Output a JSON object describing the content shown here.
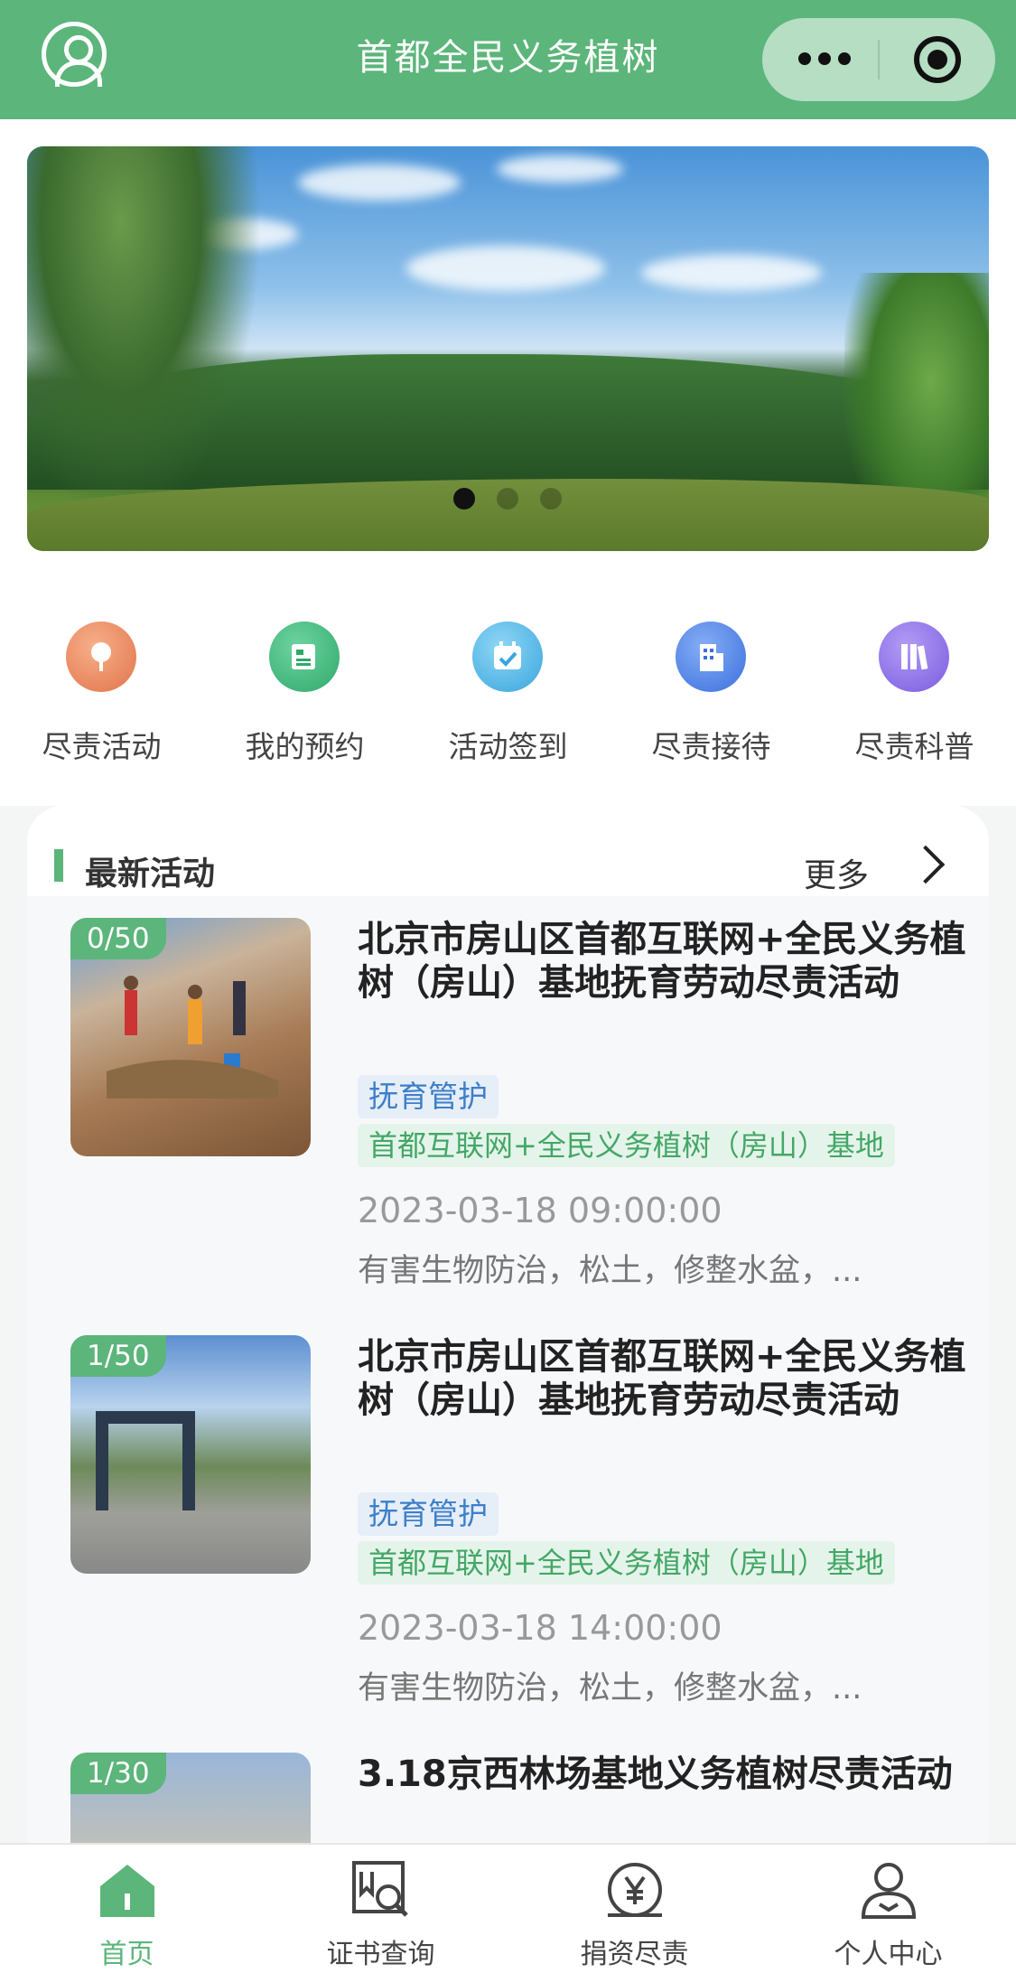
{
  "header": {
    "title": "首都全民义务植树"
  },
  "banner": {
    "slide_count": 3,
    "active_index": 0
  },
  "menu": [
    {
      "label": "尽责活动",
      "icon": "tree-icon",
      "color": "#ef8d5a"
    },
    {
      "label": "我的预约",
      "icon": "news-icon",
      "color": "#3fb87d"
    },
    {
      "label": "活动签到",
      "icon": "calendar-check-icon",
      "color": "#4fb6e8"
    },
    {
      "label": "尽责接待",
      "icon": "building-icon",
      "color": "#4a82e6"
    },
    {
      "label": "尽责科普",
      "icon": "books-icon",
      "color": "#8a6ee6"
    }
  ],
  "section": {
    "title": "最新活动",
    "more": "更多"
  },
  "activities": [
    {
      "count": "0/50",
      "title": "北京市房山区首都互联网+全民义务植树（房山）基地抚育劳动尽责活动",
      "category": "抚育管护",
      "base": "首都互联网+全民义务植树（房山）基地",
      "time": "2023-03-18 09:00:00",
      "desc": "有害生物防治，松土，修整水盆，..."
    },
    {
      "count": "1/50",
      "title": "北京市房山区首都互联网+全民义务植树（房山）基地抚育劳动尽责活动",
      "category": "抚育管护",
      "base": "首都互联网+全民义务植树（房山）基地",
      "time": "2023-03-18 14:00:00",
      "desc": "有害生物防治，松土，修整水盆，..."
    },
    {
      "count": "1/30",
      "title": "3.18京西林场基地义务植树尽责活动"
    }
  ],
  "tabbar": [
    {
      "label": "首页",
      "icon": "home-icon",
      "active": true
    },
    {
      "label": "证书查询",
      "icon": "certificate-search-icon",
      "active": false
    },
    {
      "label": "捐资尽责",
      "icon": "yuan-icon",
      "active": false
    },
    {
      "label": "个人中心",
      "icon": "user-icon",
      "active": false
    }
  ],
  "colors": {
    "brand_green": "#5cb57a",
    "tag_blue": "#3d7fc9",
    "tag_green": "#43a767"
  }
}
